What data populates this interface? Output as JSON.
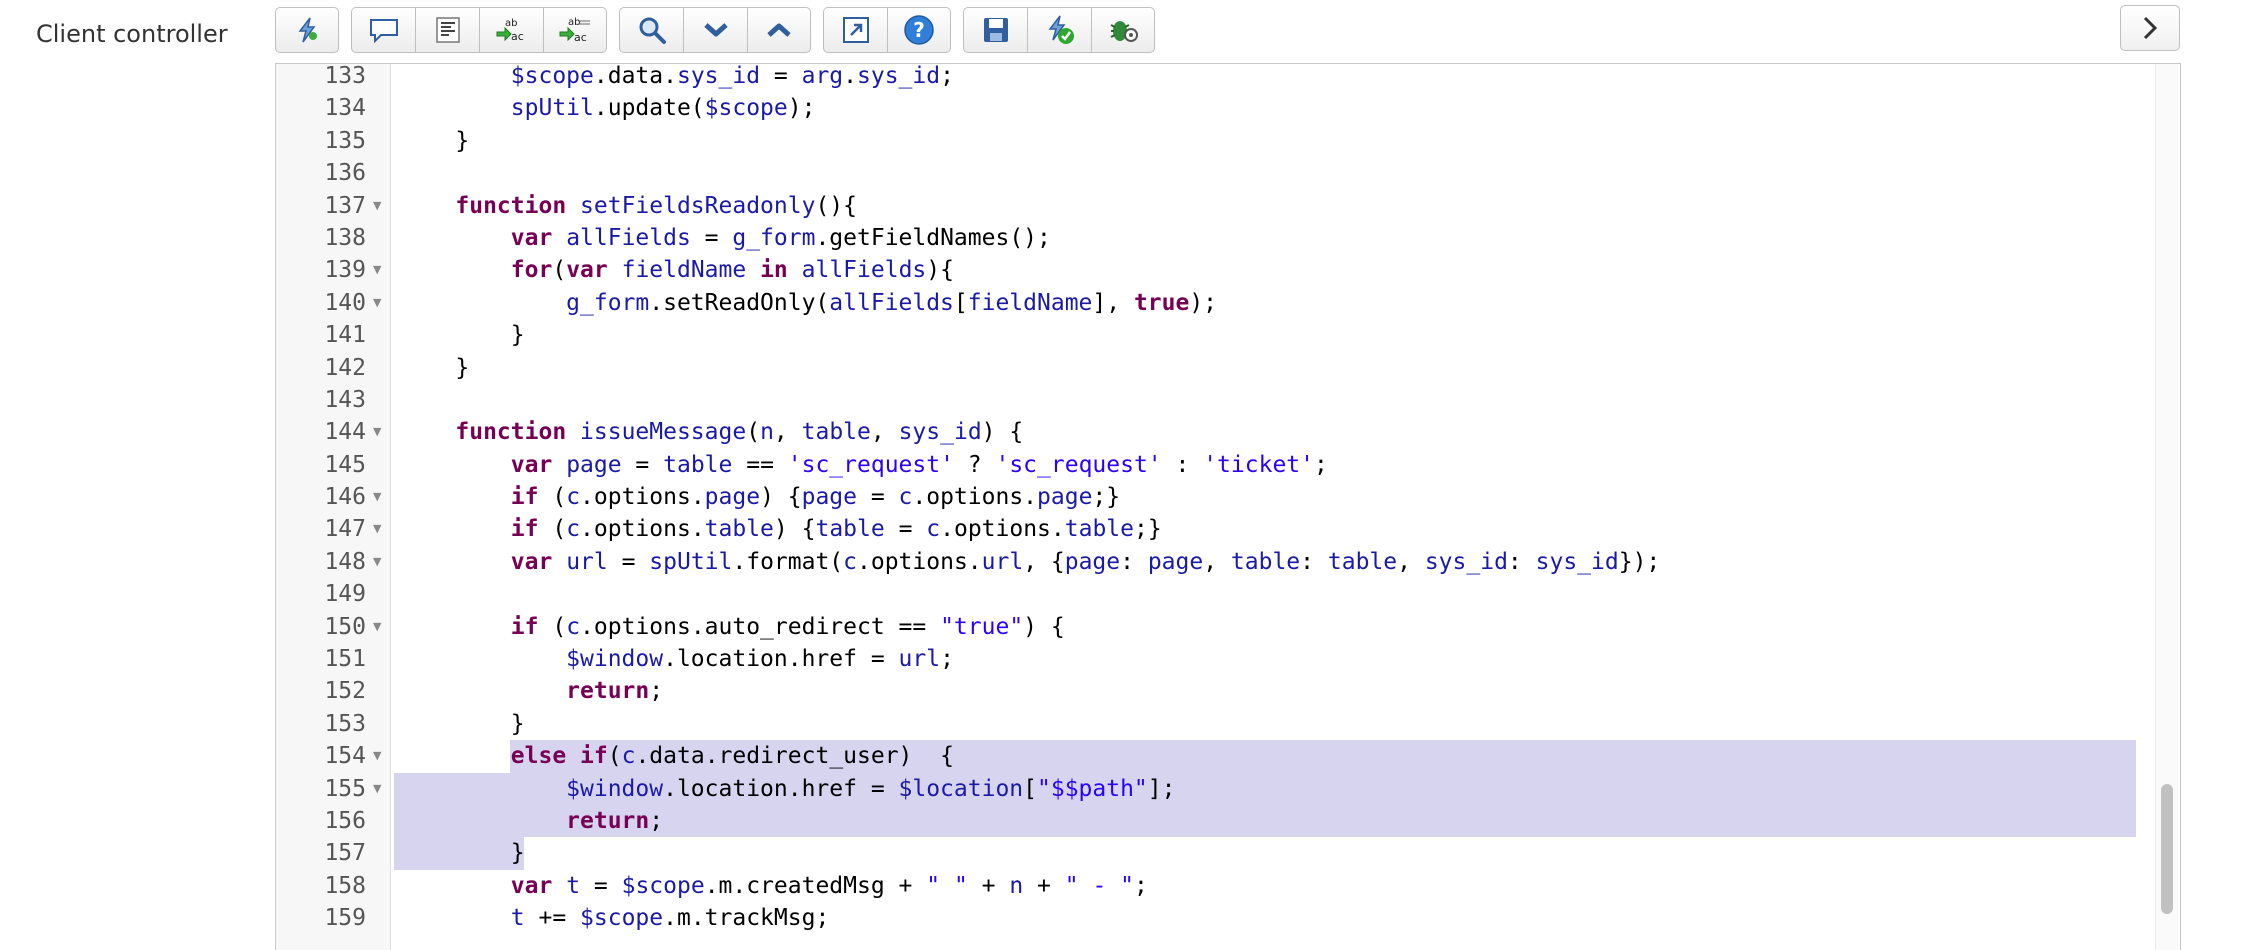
{
  "field_label": "Client controller",
  "toolbar": {
    "groups": [
      [
        {
          "icon": "script-include-icon",
          "title": "Toggle syntax"
        }
      ],
      [
        {
          "icon": "comment-icon"
        },
        {
          "icon": "format-code-icon"
        },
        {
          "icon": "replace-icon"
        },
        {
          "icon": "replace-all-icon"
        }
      ],
      [
        {
          "icon": "search-icon"
        },
        {
          "icon": "find-next-icon"
        },
        {
          "icon": "find-previous-icon"
        }
      ],
      [
        {
          "icon": "fullscreen-icon"
        },
        {
          "icon": "help-icon"
        }
      ],
      [
        {
          "icon": "save-icon"
        },
        {
          "icon": "check-syntax-icon"
        },
        {
          "icon": "debug-icon"
        }
      ]
    ],
    "collapse_icon": "chevron-right-icon"
  },
  "colors": {
    "selection": "#d7d4f0",
    "keyword": "#770055",
    "variable": "#1a1aa6",
    "string": "#2a00ff"
  },
  "code_lines": [
    {
      "n": "133",
      "fold": false,
      "text": "        $scope.data.sys_id = arg.sys_id;"
    },
    {
      "n": "134",
      "fold": false,
      "text": "        spUtil.update($scope);"
    },
    {
      "n": "135",
      "fold": false,
      "text": "    }"
    },
    {
      "n": "136",
      "fold": false,
      "text": ""
    },
    {
      "n": "137",
      "fold": true,
      "text": "    function setFieldsReadonly(){"
    },
    {
      "n": "138",
      "fold": false,
      "text": "        var allFields = g_form.getFieldNames();"
    },
    {
      "n": "139",
      "fold": true,
      "text": "        for(var fieldName in allFields){"
    },
    {
      "n": "140",
      "fold": true,
      "text": "            g_form.setReadOnly(allFields[fieldName], true);"
    },
    {
      "n": "141",
      "fold": false,
      "text": "        }"
    },
    {
      "n": "142",
      "fold": false,
      "text": "    }"
    },
    {
      "n": "143",
      "fold": false,
      "text": ""
    },
    {
      "n": "144",
      "fold": true,
      "text": "    function issueMessage(n, table, sys_id) {"
    },
    {
      "n": "145",
      "fold": false,
      "text": "        var page = table == 'sc_request' ? 'sc_request' : 'ticket';"
    },
    {
      "n": "146",
      "fold": true,
      "text": "        if (c.options.page) {page = c.options.page;}"
    },
    {
      "n": "147",
      "fold": true,
      "text": "        if (c.options.table) {table = c.options.table;}"
    },
    {
      "n": "148",
      "fold": true,
      "text": "        var url = spUtil.format(c.options.url, {page: page, table: table, sys_id: sys_id});"
    },
    {
      "n": "149",
      "fold": false,
      "text": ""
    },
    {
      "n": "150",
      "fold": true,
      "text": "        if (c.options.auto_redirect == \"true\") {"
    },
    {
      "n": "151",
      "fold": false,
      "text": "            $window.location.href = url;"
    },
    {
      "n": "152",
      "fold": false,
      "text": "            return;"
    },
    {
      "n": "153",
      "fold": false,
      "text": "        }"
    },
    {
      "n": "154",
      "fold": true,
      "text": "        else if(c.data.redirect_user)  {"
    },
    {
      "n": "155",
      "fold": true,
      "text": "            $window.location.href = $location[\"$$path\"];"
    },
    {
      "n": "156",
      "fold": false,
      "text": "            return;"
    },
    {
      "n": "157",
      "fold": false,
      "text": "        }"
    },
    {
      "n": "158",
      "fold": false,
      "text": "        var t = $scope.m.createdMsg + \" \" + n + \" - \";"
    },
    {
      "n": "159",
      "fold": false,
      "text": "        t += $scope.m.trackMsg;"
    }
  ]
}
